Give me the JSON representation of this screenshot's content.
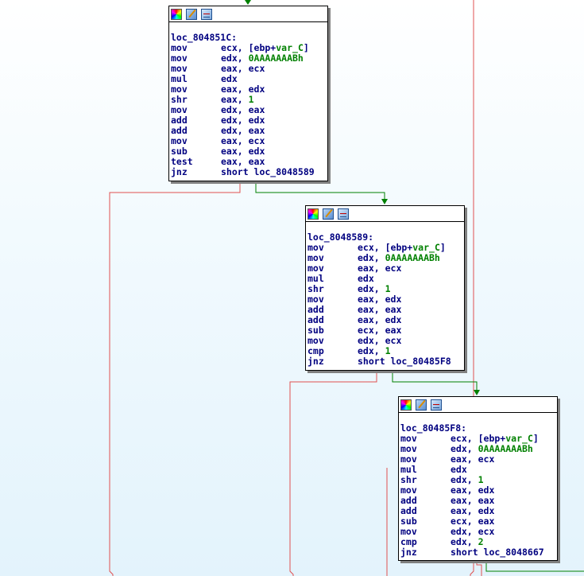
{
  "blocks": [
    {
      "label": "loc_804851C:",
      "lines": [
        {
          "mnemonic": "mov",
          "op_pre": "ecx, [ebp+",
          "op_hl": "var_C",
          "op_post": "]"
        },
        {
          "mnemonic": "mov",
          "op_pre": "edx, ",
          "op_hl": "0AAAAAAABh",
          "op_post": ""
        },
        {
          "mnemonic": "mov",
          "op_pre": "eax, ecx",
          "op_hl": "",
          "op_post": ""
        },
        {
          "mnemonic": "mul",
          "op_pre": "edx",
          "op_hl": "",
          "op_post": ""
        },
        {
          "mnemonic": "mov",
          "op_pre": "eax, edx",
          "op_hl": "",
          "op_post": ""
        },
        {
          "mnemonic": "shr",
          "op_pre": "eax, ",
          "op_hl": "1",
          "op_post": ""
        },
        {
          "mnemonic": "mov",
          "op_pre": "edx, eax",
          "op_hl": "",
          "op_post": ""
        },
        {
          "mnemonic": "add",
          "op_pre": "edx, edx",
          "op_hl": "",
          "op_post": ""
        },
        {
          "mnemonic": "add",
          "op_pre": "edx, eax",
          "op_hl": "",
          "op_post": ""
        },
        {
          "mnemonic": "mov",
          "op_pre": "eax, ecx",
          "op_hl": "",
          "op_post": ""
        },
        {
          "mnemonic": "sub",
          "op_pre": "eax, edx",
          "op_hl": "",
          "op_post": ""
        },
        {
          "mnemonic": "test",
          "op_pre": "eax, eax",
          "op_hl": "",
          "op_post": ""
        },
        {
          "mnemonic": "jnz",
          "op_pre": "short loc_8048589",
          "op_hl": "",
          "op_post": ""
        }
      ]
    },
    {
      "label": "loc_8048589:",
      "lines": [
        {
          "mnemonic": "mov",
          "op_pre": "ecx, [ebp+",
          "op_hl": "var_C",
          "op_post": "]"
        },
        {
          "mnemonic": "mov",
          "op_pre": "edx, ",
          "op_hl": "0AAAAAAABh",
          "op_post": ""
        },
        {
          "mnemonic": "mov",
          "op_pre": "eax, ecx",
          "op_hl": "",
          "op_post": ""
        },
        {
          "mnemonic": "mul",
          "op_pre": "edx",
          "op_hl": "",
          "op_post": ""
        },
        {
          "mnemonic": "shr",
          "op_pre": "edx, ",
          "op_hl": "1",
          "op_post": ""
        },
        {
          "mnemonic": "mov",
          "op_pre": "eax, edx",
          "op_hl": "",
          "op_post": ""
        },
        {
          "mnemonic": "add",
          "op_pre": "eax, eax",
          "op_hl": "",
          "op_post": ""
        },
        {
          "mnemonic": "add",
          "op_pre": "eax, edx",
          "op_hl": "",
          "op_post": ""
        },
        {
          "mnemonic": "sub",
          "op_pre": "ecx, eax",
          "op_hl": "",
          "op_post": ""
        },
        {
          "mnemonic": "mov",
          "op_pre": "edx, ecx",
          "op_hl": "",
          "op_post": ""
        },
        {
          "mnemonic": "cmp",
          "op_pre": "edx, ",
          "op_hl": "1",
          "op_post": ""
        },
        {
          "mnemonic": "jnz",
          "op_pre": "short loc_80485F8",
          "op_hl": "",
          "op_post": ""
        }
      ]
    },
    {
      "label": "loc_80485F8:",
      "lines": [
        {
          "mnemonic": "mov",
          "op_pre": "ecx, [ebp+",
          "op_hl": "var_C",
          "op_post": "]"
        },
        {
          "mnemonic": "mov",
          "op_pre": "edx, ",
          "op_hl": "0AAAAAAABh",
          "op_post": ""
        },
        {
          "mnemonic": "mov",
          "op_pre": "eax, ecx",
          "op_hl": "",
          "op_post": ""
        },
        {
          "mnemonic": "mul",
          "op_pre": "edx",
          "op_hl": "",
          "op_post": ""
        },
        {
          "mnemonic": "shr",
          "op_pre": "edx, ",
          "op_hl": "1",
          "op_post": ""
        },
        {
          "mnemonic": "mov",
          "op_pre": "eax, edx",
          "op_hl": "",
          "op_post": ""
        },
        {
          "mnemonic": "add",
          "op_pre": "eax, eax",
          "op_hl": "",
          "op_post": ""
        },
        {
          "mnemonic": "add",
          "op_pre": "eax, edx",
          "op_hl": "",
          "op_post": ""
        },
        {
          "mnemonic": "sub",
          "op_pre": "ecx, eax",
          "op_hl": "",
          "op_post": ""
        },
        {
          "mnemonic": "mov",
          "op_pre": "edx, ecx",
          "op_hl": "",
          "op_post": ""
        },
        {
          "mnemonic": "cmp",
          "op_pre": "edx, ",
          "op_hl": "2",
          "op_post": ""
        },
        {
          "mnemonic": "jnz",
          "op_pre": "short loc_8048667",
          "op_hl": "",
          "op_post": ""
        }
      ]
    }
  ],
  "header_icons": [
    "color-palette-icon",
    "rename-pencil-icon",
    "graph-overview-icon"
  ],
  "colors": {
    "true_edge": "#008000",
    "false_edge": "#e05050",
    "instruction_text": "#000080",
    "immediate_text": "#008000",
    "block_shadow": "#808080"
  }
}
